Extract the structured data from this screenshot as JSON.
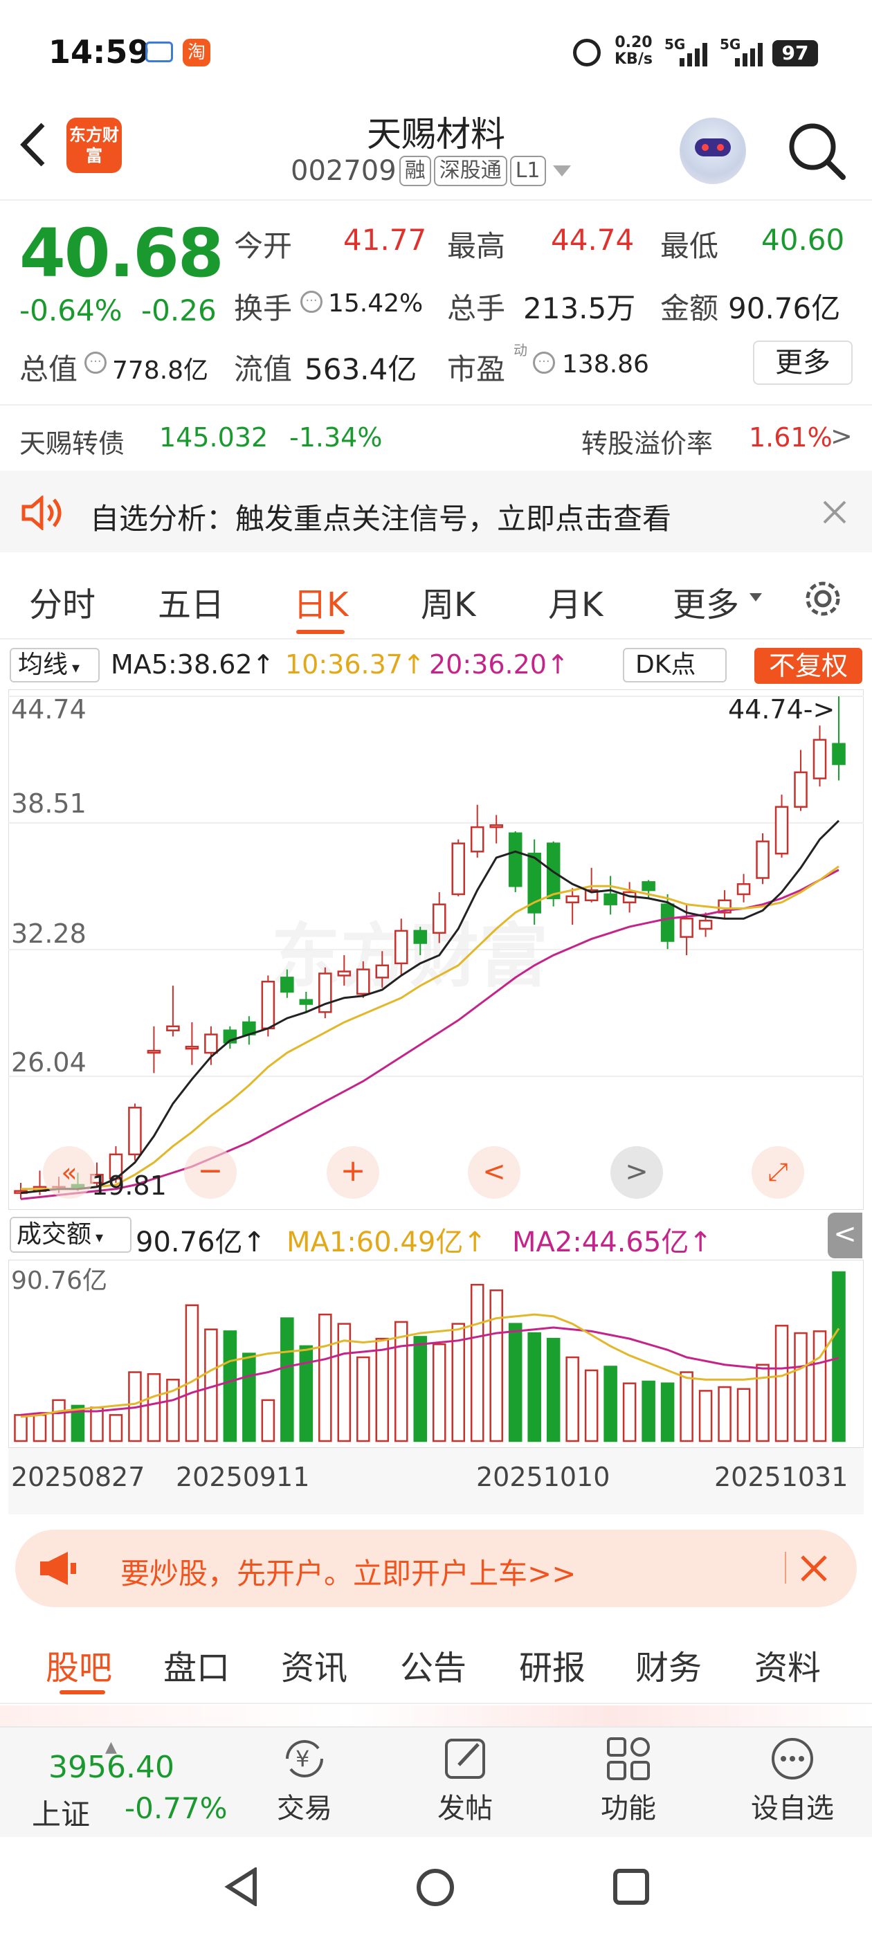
{
  "status_bar": {
    "time": "14:59",
    "net_speed": "0.20",
    "net_unit": "KB/s",
    "sig1": "5G",
    "sig2": "5G",
    "battery": "97"
  },
  "header": {
    "title": "天赐材料",
    "code": "002709",
    "tags": [
      "融",
      "深股通",
      "L1"
    ],
    "logo_text": "东方财富"
  },
  "quote": {
    "price": "40.68",
    "change_pct": "-0.64%",
    "change": "-0.26",
    "open_label": "今开",
    "open": "41.77",
    "high_label": "最高",
    "high": "44.74",
    "low_label": "最低",
    "low": "40.60",
    "turnover_label": "换手",
    "turnover": "15.42%",
    "volume_label": "总手",
    "volume": "213.5万",
    "amount_label": "金额",
    "amount": "90.76亿",
    "mcap_label": "总值",
    "mcap": "778.8亿",
    "float_label": "流值",
    "float": "563.4亿",
    "pe_label": "市盈",
    "pe_sup": "动",
    "pe": "138.86",
    "more_button": "更多"
  },
  "bond": {
    "name": "天赐转债",
    "price": "145.032",
    "pct": "-1.34%",
    "premium_label": "转股溢价率",
    "premium": "1.61%"
  },
  "notice": {
    "text": "自选分析：触发重点关注信号，立即点击查看"
  },
  "chart_tabs": [
    {
      "label": "分时"
    },
    {
      "label": "五日"
    },
    {
      "label": "日K"
    },
    {
      "label": "周K"
    },
    {
      "label": "月K"
    },
    {
      "label": "更多"
    }
  ],
  "ma_bar": {
    "select": "均线",
    "ma5": "MA5:38.62",
    "ma10": "10:36.37",
    "ma20": "20:36.20",
    "dk": "DK点",
    "fq": "不复权"
  },
  "kline": {
    "y_labels": [
      "44.74",
      "38.51",
      "32.28",
      "26.04"
    ],
    "max_note": "44.74->",
    "min_note": "19.81"
  },
  "vol_bar": {
    "select": "成交额",
    "vol": "90.76亿",
    "ma1": "MA1:60.49亿",
    "ma2": "MA2:44.65亿",
    "ylabel": "90.76亿"
  },
  "dates": [
    "20250827",
    "20250911",
    "20251010",
    "20251031"
  ],
  "ad": {
    "text": "要炒股，先开户。立即开户上车>>"
  },
  "sub_tabs": [
    {
      "label": "股吧"
    },
    {
      "label": "盘口"
    },
    {
      "label": "资讯"
    },
    {
      "label": "公告"
    },
    {
      "label": "研报"
    },
    {
      "label": "财务"
    },
    {
      "label": "资料"
    }
  ],
  "bottom": {
    "index_value": "3956.40",
    "index_name": "上证",
    "index_pct": "-0.77%",
    "items": [
      {
        "label": "交易"
      },
      {
        "label": "发帖"
      },
      {
        "label": "功能"
      },
      {
        "label": "设自选"
      }
    ]
  },
  "chart_data": {
    "type": "candlestick",
    "ylim": [
      19.81,
      44.74
    ],
    "y_ticks": [
      44.74,
      38.51,
      32.28,
      26.04
    ],
    "x_labels": [
      "20250827",
      "20250911",
      "20251010",
      "20251031"
    ],
    "candles": [
      {
        "o": 20.3,
        "c": 20.4,
        "h": 20.8,
        "l": 20.0
      },
      {
        "o": 20.4,
        "c": 20.6,
        "h": 21.4,
        "l": 20.2
      },
      {
        "o": 20.5,
        "c": 20.6,
        "h": 21.1,
        "l": 20.3
      },
      {
        "o": 20.7,
        "c": 20.6,
        "h": 21.3,
        "l": 20.4
      },
      {
        "o": 20.8,
        "c": 21.2,
        "h": 21.8,
        "l": 20.6
      },
      {
        "o": 21.0,
        "c": 22.2,
        "h": 22.6,
        "l": 20.8
      },
      {
        "o": 22.2,
        "c": 24.5,
        "h": 24.7,
        "l": 21.9
      },
      {
        "o": 27.2,
        "c": 27.3,
        "h": 28.5,
        "l": 26.2
      },
      {
        "o": 28.3,
        "c": 28.5,
        "h": 30.5,
        "l": 28.0
      },
      {
        "o": 27.4,
        "c": 27.5,
        "h": 28.7,
        "l": 26.6
      },
      {
        "o": 27.2,
        "c": 28.1,
        "h": 28.5,
        "l": 26.6
      },
      {
        "o": 28.3,
        "c": 27.7,
        "h": 28.5,
        "l": 27.4
      },
      {
        "o": 28.7,
        "c": 28.1,
        "h": 29.0,
        "l": 27.6
      },
      {
        "o": 28.4,
        "c": 30.7,
        "h": 31.0,
        "l": 28.0
      },
      {
        "o": 30.9,
        "c": 30.2,
        "h": 31.3,
        "l": 29.9
      },
      {
        "o": 29.8,
        "c": 29.6,
        "h": 30.2,
        "l": 29.2
      },
      {
        "o": 29.2,
        "c": 31.1,
        "h": 31.4,
        "l": 28.9
      },
      {
        "o": 31.0,
        "c": 31.2,
        "h": 32.0,
        "l": 30.5
      },
      {
        "o": 30.1,
        "c": 31.3,
        "h": 31.7,
        "l": 29.9
      },
      {
        "o": 30.9,
        "c": 31.5,
        "h": 32.2,
        "l": 30.4
      },
      {
        "o": 31.6,
        "c": 33.2,
        "h": 33.8,
        "l": 31.0
      },
      {
        "o": 33.2,
        "c": 32.6,
        "h": 33.4,
        "l": 32.0
      },
      {
        "o": 33.1,
        "c": 34.5,
        "h": 35.1,
        "l": 32.6
      },
      {
        "o": 35.0,
        "c": 37.5,
        "h": 37.7,
        "l": 34.9
      },
      {
        "o": 37.1,
        "c": 38.3,
        "h": 39.4,
        "l": 36.8
      },
      {
        "o": 38.3,
        "c": 38.4,
        "h": 38.9,
        "l": 37.5
      },
      {
        "o": 38.0,
        "c": 35.4,
        "h": 38.1,
        "l": 35.1
      },
      {
        "o": 37.0,
        "c": 34.1,
        "h": 37.7,
        "l": 33.5
      },
      {
        "o": 37.5,
        "c": 34.8,
        "h": 37.6,
        "l": 34.4
      },
      {
        "o": 34.6,
        "c": 34.9,
        "h": 35.3,
        "l": 33.5
      },
      {
        "o": 34.7,
        "c": 35.2,
        "h": 36.3,
        "l": 34.6
      },
      {
        "o": 35.0,
        "c": 34.5,
        "h": 35.9,
        "l": 34.0
      },
      {
        "o": 34.6,
        "c": 35.1,
        "h": 35.6,
        "l": 34.1
      },
      {
        "o": 35.6,
        "c": 35.2,
        "h": 35.7,
        "l": 34.8
      },
      {
        "o": 34.5,
        "c": 32.7,
        "h": 35.0,
        "l": 32.3
      },
      {
        "o": 32.9,
        "c": 33.8,
        "h": 34.5,
        "l": 32.0
      },
      {
        "o": 33.3,
        "c": 33.7,
        "h": 34.1,
        "l": 32.9
      },
      {
        "o": 34.1,
        "c": 34.7,
        "h": 35.2,
        "l": 33.8
      },
      {
        "o": 35.0,
        "c": 35.5,
        "h": 36.0,
        "l": 34.6
      },
      {
        "o": 35.8,
        "c": 37.6,
        "h": 38.0,
        "l": 35.5
      },
      {
        "o": 37.0,
        "c": 39.3,
        "h": 39.9,
        "l": 36.8
      },
      {
        "o": 39.3,
        "c": 41.0,
        "h": 42.1,
        "l": 39.1
      },
      {
        "o": 40.7,
        "c": 42.6,
        "h": 43.3,
        "l": 40.3
      },
      {
        "o": 42.4,
        "c": 41.4,
        "h": 44.74,
        "l": 40.6
      }
    ],
    "ma5": [
      20.3,
      20.4,
      20.5,
      20.5,
      20.6,
      21.0,
      21.8,
      23.1,
      24.7,
      25.9,
      27.0,
      27.8,
      28.1,
      28.4,
      28.9,
      29.2,
      29.6,
      29.9,
      30.0,
      30.3,
      31.0,
      31.6,
      32.0,
      33.3,
      35.2,
      36.8,
      37.1,
      36.8,
      36.1,
      35.5,
      35.1,
      35.2,
      34.9,
      34.8,
      34.6,
      34.1,
      33.9,
      33.8,
      33.8,
      34.2,
      35.1,
      36.3,
      37.7,
      38.62
    ],
    "ma10": [
      20.5,
      20.5,
      20.5,
      20.5,
      20.6,
      20.7,
      21.2,
      21.8,
      22.6,
      23.3,
      24.1,
      24.8,
      25.6,
      26.5,
      27.2,
      27.7,
      28.2,
      28.7,
      29.1,
      29.5,
      29.9,
      30.5,
      31.0,
      31.5,
      32.4,
      33.3,
      34.1,
      34.6,
      35.0,
      35.2,
      35.4,
      35.4,
      35.2,
      35.0,
      34.8,
      34.5,
      34.4,
      34.3,
      34.3,
      34.4,
      34.6,
      35.1,
      35.7,
      36.37
    ],
    "ma20": [
      20.0,
      20.1,
      20.2,
      20.3,
      20.4,
      20.5,
      20.7,
      21.0,
      21.3,
      21.6,
      22.0,
      22.4,
      22.8,
      23.3,
      23.8,
      24.3,
      24.8,
      25.3,
      25.8,
      26.4,
      27.0,
      27.6,
      28.2,
      28.8,
      29.5,
      30.2,
      30.9,
      31.5,
      32.0,
      32.4,
      32.8,
      33.1,
      33.4,
      33.6,
      33.8,
      33.9,
      34.0,
      34.2,
      34.3,
      34.5,
      34.8,
      35.2,
      35.7,
      36.2
    ],
    "amount_ylim": [
      0,
      90.76
    ],
    "amounts": [
      14,
      14,
      22,
      19,
      18,
      14,
      37,
      36,
      33,
      73,
      60,
      59,
      47,
      22,
      66,
      51,
      68,
      63,
      45,
      55,
      64,
      56,
      52,
      63,
      84,
      81,
      63,
      58,
      55,
      45,
      38,
      40,
      31,
      32,
      31,
      37,
      27,
      29,
      28,
      41,
      62,
      58,
      59,
      90.76
    ],
    "amount_ma1": [
      13,
      14,
      16,
      17,
      18,
      19,
      20,
      24,
      27,
      32,
      38,
      43,
      45,
      47,
      48,
      49,
      51,
      54,
      53,
      54,
      56,
      58,
      59,
      60,
      63,
      66,
      67,
      68,
      67,
      63,
      57,
      51,
      46,
      42,
      38,
      34,
      33,
      33,
      33,
      34,
      35,
      39,
      45,
      60.49
    ],
    "amount_ma2": [
      14,
      15,
      15,
      16,
      16,
      17,
      18,
      20,
      22,
      26,
      29,
      32,
      35,
      37,
      40,
      42,
      44,
      47,
      48,
      49,
      51,
      52,
      53,
      54,
      56,
      58,
      59,
      60,
      61,
      60,
      59,
      57,
      55,
      52,
      49,
      45,
      43,
      41,
      40,
      39,
      39,
      40,
      42,
      44.65
    ]
  }
}
